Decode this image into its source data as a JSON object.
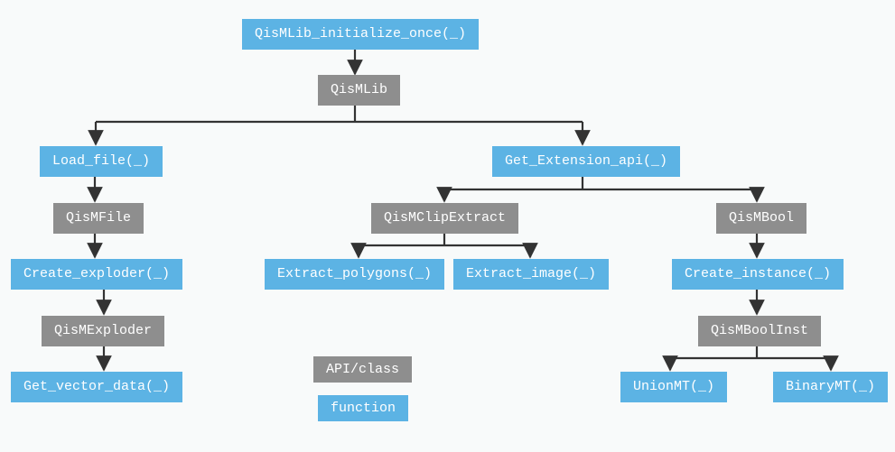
{
  "nodes": {
    "init": {
      "label": "QisMLib_initialize_once(_)",
      "type": "fn"
    },
    "qismlib": {
      "label": "QisMLib",
      "type": "cls"
    },
    "loadfile": {
      "label": "Load_file(_)",
      "type": "fn"
    },
    "getext": {
      "label": "Get_Extension_api(_)",
      "type": "fn"
    },
    "qismfile": {
      "label": "QisMFile",
      "type": "cls"
    },
    "clipext": {
      "label": "QisMClipExtract",
      "type": "cls"
    },
    "qismbool": {
      "label": "QisMBool",
      "type": "cls"
    },
    "createexp": {
      "label": "Create_exploder(_)",
      "type": "fn"
    },
    "extpoly": {
      "label": "Extract_polygons(_)",
      "type": "fn"
    },
    "extimg": {
      "label": "Extract_image(_)",
      "type": "fn"
    },
    "createinst": {
      "label": "Create_instance(_)",
      "type": "fn"
    },
    "exploder": {
      "label": "QisMExploder",
      "type": "cls"
    },
    "boolinst": {
      "label": "QisMBoolInst",
      "type": "cls"
    },
    "getvec": {
      "label": "Get_vector_data(_)",
      "type": "fn"
    },
    "unionmt": {
      "label": "UnionMT(_)",
      "type": "fn"
    },
    "binarymt": {
      "label": "BinaryMT(_)",
      "type": "fn"
    }
  },
  "legend": {
    "cls": "API/class",
    "fn": "function"
  },
  "edges_desc": "init->qismlib; qismlib->loadfile,getext; loadfile->qismfile->createexp->exploder->getvec; getext->clipext,qismbool; clipext->extpoly,extimg; qismbool->createinst->boolinst->unionmt,binarymt"
}
